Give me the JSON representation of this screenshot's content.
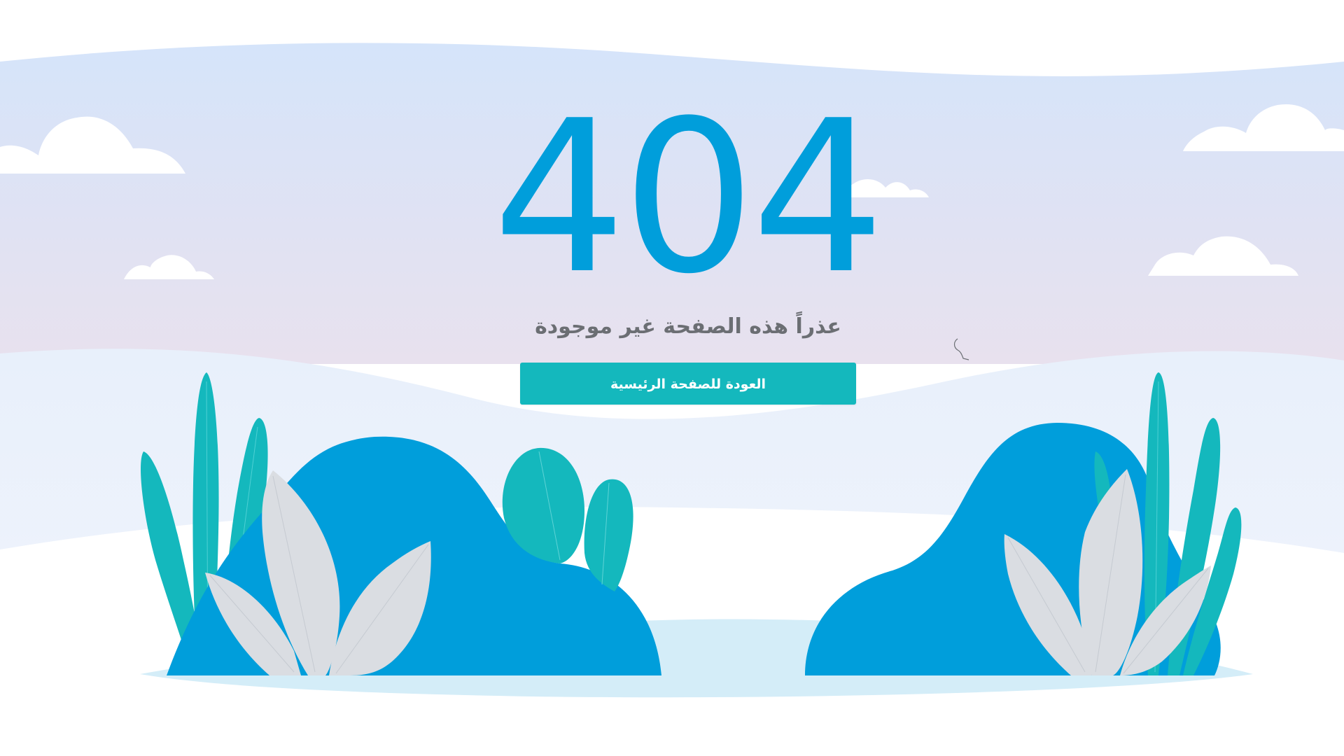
{
  "page": {
    "error_code": "404",
    "message": "عذراً هذه الصفحة غير موجودة",
    "home_button_label": "العودة للصفحة الرئيسية"
  },
  "colors": {
    "primary_blue": "#009edb",
    "button_teal": "#14b8bd",
    "message_gray": "#6b6e73",
    "sky_top": "#d6e6fa",
    "sky_bottom": "#e8e2f0",
    "cloud_white": "#ffffff",
    "leaf_gray": "#dadde2",
    "pond_light_blue": "#d4edf8"
  },
  "icons": {
    "cursor": "loading-cursor-icon"
  }
}
